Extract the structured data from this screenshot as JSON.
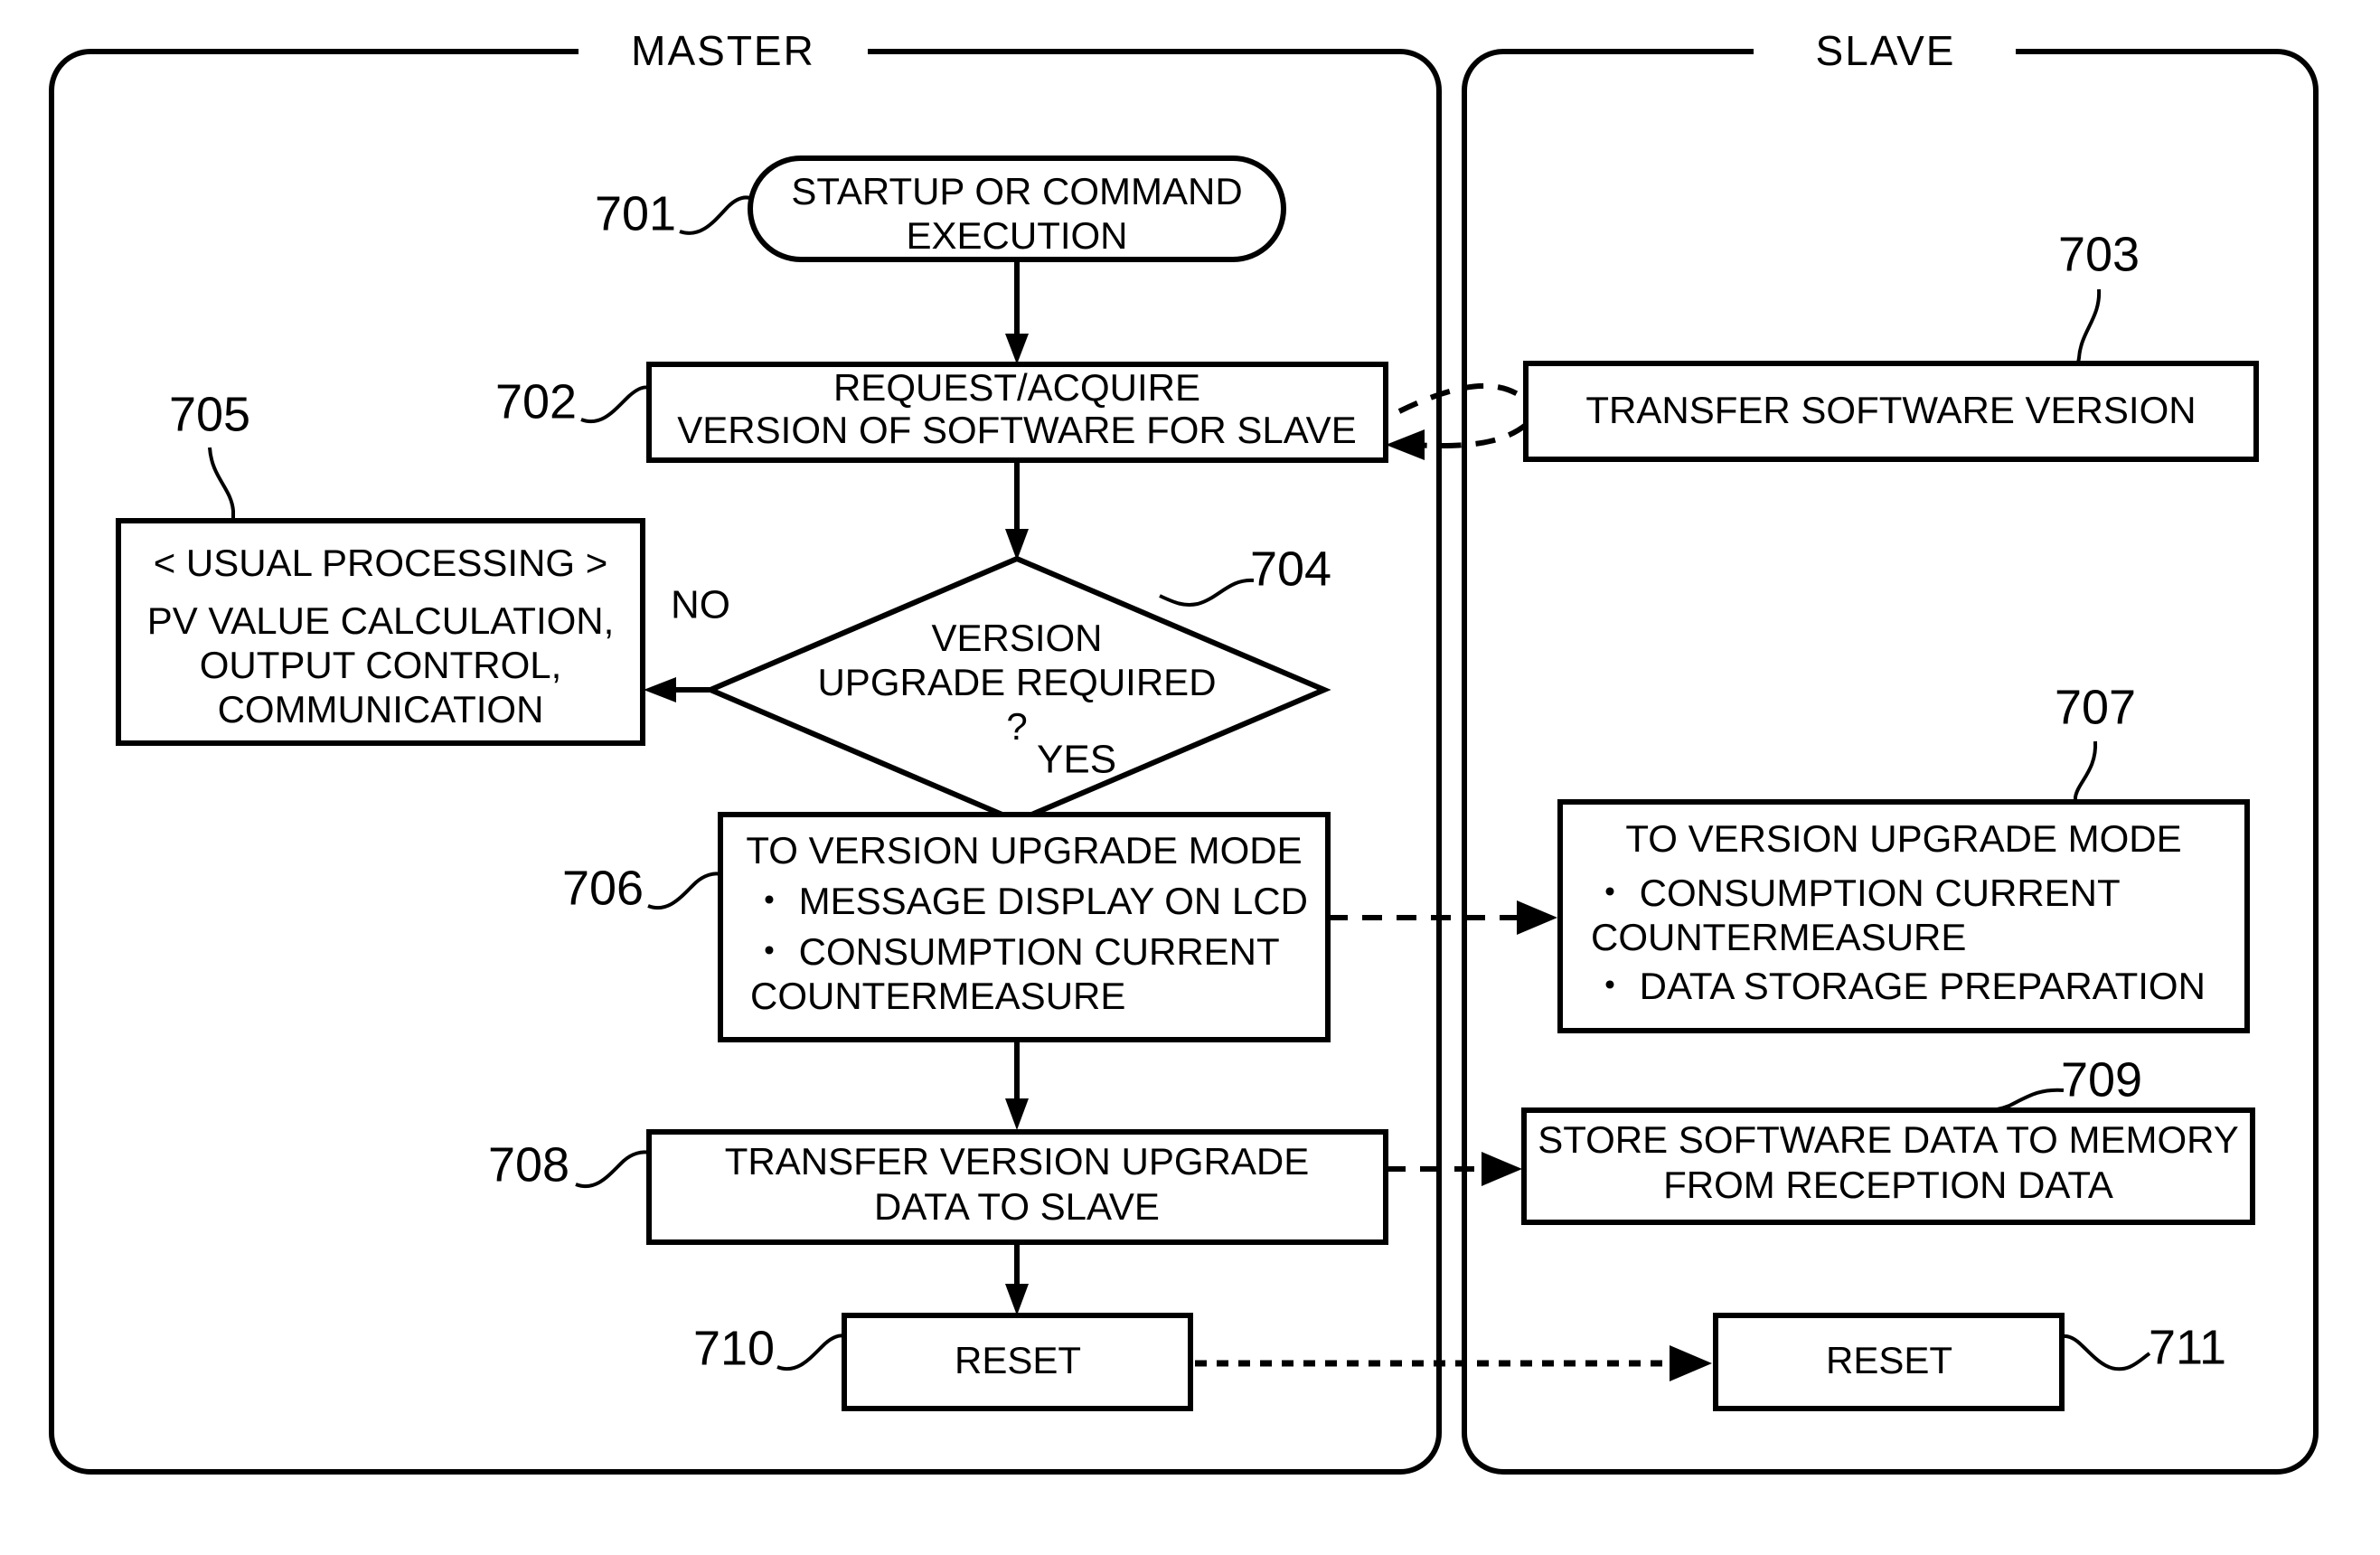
{
  "figure": {
    "panels": [
      {
        "id": "master",
        "title": "MASTER"
      },
      {
        "id": "slave",
        "title": "SLAVE"
      }
    ],
    "nodes": {
      "n701": {
        "ref": "701",
        "shape": "terminator",
        "lines": [
          "STARTUP OR COMMAND",
          "EXECUTION"
        ]
      },
      "n702": {
        "ref": "702",
        "shape": "process",
        "lines": [
          "REQUEST/ACQUIRE",
          "VERSION OF SOFTWARE FOR SLAVE"
        ]
      },
      "n703": {
        "ref": "703",
        "shape": "process",
        "lines": [
          "TRANSFER SOFTWARE VERSION"
        ]
      },
      "n704": {
        "ref": "704",
        "shape": "decision",
        "lines": [
          "VERSION",
          "UPGRADE REQUIRED",
          "?"
        ]
      },
      "n705": {
        "ref": "705",
        "shape": "process",
        "lines": [
          "< USUAL PROCESSING >",
          "PV VALUE CALCULATION,",
          "OUTPUT CONTROL,",
          "COMMUNICATION"
        ]
      },
      "n706": {
        "ref": "706",
        "shape": "process",
        "lines": [
          "TO VERSION UPGRADE MODE",
          "・ MESSAGE DISPLAY ON LCD",
          "・ CONSUMPTION CURRENT",
          "   COUNTERMEASURE"
        ]
      },
      "n707": {
        "ref": "707",
        "shape": "process",
        "lines": [
          "TO VERSION UPGRADE MODE",
          "・ CONSUMPTION CURRENT",
          "   COUNTERMEASURE",
          "・ DATA STORAGE PREPARATION"
        ]
      },
      "n708": {
        "ref": "708",
        "shape": "process",
        "lines": [
          "TRANSFER VERSION UPGRADE",
          "DATA TO SLAVE"
        ]
      },
      "n709": {
        "ref": "709",
        "shape": "process",
        "lines": [
          "STORE SOFTWARE DATA TO MEMORY",
          "FROM RECEPTION DATA"
        ]
      },
      "n710": {
        "ref": "710",
        "shape": "process",
        "lines": [
          "RESET"
        ]
      },
      "n711": {
        "ref": "711",
        "shape": "process",
        "lines": [
          "RESET"
        ]
      }
    },
    "branch_labels": {
      "no": "NO",
      "yes": "YES"
    },
    "colors": {
      "line": "#000000",
      "background": "#ffffff",
      "text": "#000000"
    }
  }
}
